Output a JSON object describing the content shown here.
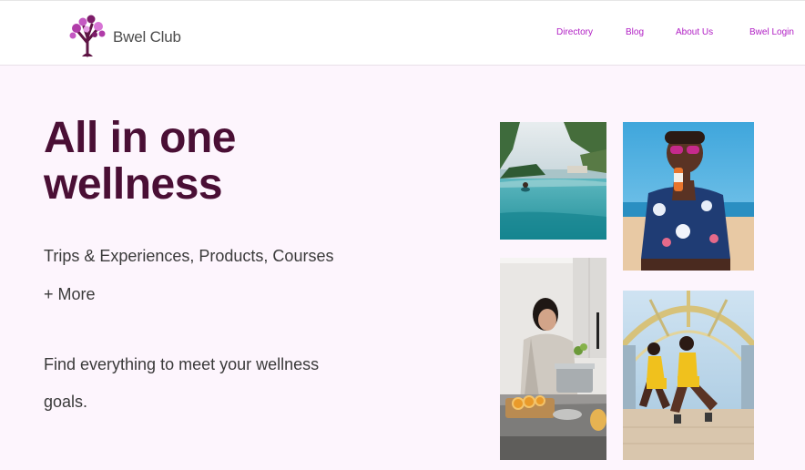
{
  "header": {
    "brand": "Bwel Club",
    "nav": [
      {
        "label": "Directory"
      },
      {
        "label": "Blog"
      },
      {
        "label": "About Us"
      },
      {
        "label": "Bwel Login"
      }
    ]
  },
  "hero": {
    "title_line1": "All in one",
    "title_line2": "wellness",
    "categories_line1": "Trips & Experiences,  Products, Courses",
    "categories_line2": "+ More",
    "tagline_line1": "Find everything to meet your wellness",
    "tagline_line2": "goals."
  },
  "colors": {
    "accent": "#b01ec4",
    "title": "#4a0f35",
    "page_bg": "#fdf5fd"
  },
  "photos": [
    {
      "name": "infinity-pool-photo"
    },
    {
      "name": "woman-with-sunglasses-photo"
    },
    {
      "name": "woman-cooking-photo"
    },
    {
      "name": "women-exercising-photo"
    }
  ]
}
